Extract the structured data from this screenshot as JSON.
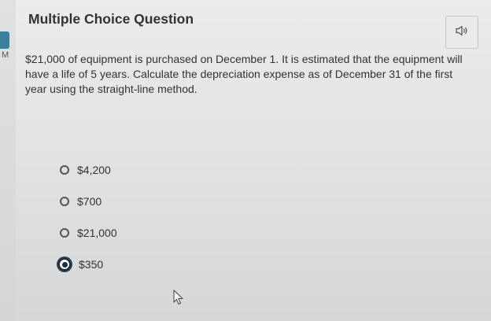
{
  "sidebar": {
    "letter": "M"
  },
  "header": {
    "title": "Multiple Choice Question"
  },
  "question": {
    "text": "$21,000 of equipment is purchased on December 1. It is estimated that the equipment will have a life of 5 years. Calculate the depreciation expense as of December 31 of the first year using the straight-line method."
  },
  "options": [
    {
      "label": "$4,200",
      "selected": false
    },
    {
      "label": "$700",
      "selected": false
    },
    {
      "label": "$21,000",
      "selected": false
    },
    {
      "label": "$350",
      "selected": true
    }
  ],
  "icons": {
    "audio": "speaker-icon",
    "cursor": "mouse-pointer-icon"
  }
}
